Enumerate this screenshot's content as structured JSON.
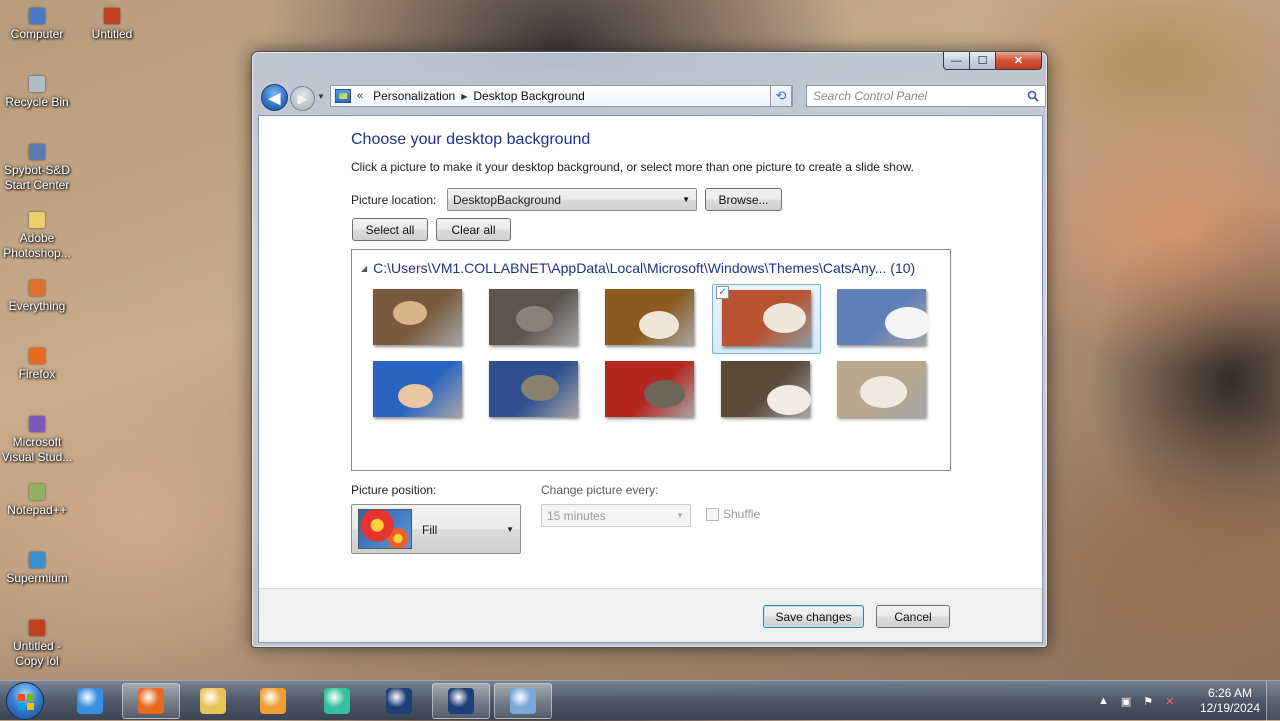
{
  "desktop": {
    "icons": [
      {
        "label": "Computer",
        "color": "#4a78c8"
      },
      {
        "label": "Untitled",
        "color": "#c04020"
      },
      {
        "label": "Recycle Bin",
        "color": "#b0bcc8"
      },
      {
        "label": "Spybot-S&D Start Center",
        "color": "#5a7ab0"
      },
      {
        "label": "Adobe Photoshop...",
        "color": "#e8d070"
      },
      {
        "label": "Everything",
        "color": "#e07030"
      },
      {
        "label": "Firefox",
        "color": "#e86a20"
      },
      {
        "label": "Microsoft Visual Stud...",
        "color": "#7a5ab8"
      },
      {
        "label": "Notepad++",
        "color": "#8fb060"
      },
      {
        "label": "Supermium",
        "color": "#3a90d0"
      },
      {
        "label": "Untitled - Copy lol",
        "color": "#c04020"
      }
    ]
  },
  "window": {
    "caption": {
      "minimize": "—",
      "maximize": "☐",
      "close": "✕"
    },
    "nav": {
      "back_icon": "back-arrow-icon",
      "forward_icon": "forward-arrow-icon",
      "address_prefix": "«",
      "breadcrumb": [
        "Personalization",
        "Desktop Background"
      ],
      "search_placeholder": "Search Control Panel"
    },
    "heading": "Choose your desktop background",
    "subtext": "Click a picture to make it your desktop background, or select more than one picture to create a slide show.",
    "picture_location": {
      "label": "Picture location:",
      "value": "DesktopBackground",
      "browse": "Browse..."
    },
    "select_all": "Select all",
    "clear_all": "Clear all",
    "gallery": {
      "group_header": "C:\\Users\\VM1.COLLABNET\\AppData\\Local\\Microsoft\\Windows\\Themes\\CatsAny... (10)",
      "thumbs": [
        {
          "bg": "#7a5a3e",
          "cat": "#d9b48a",
          "selected": false,
          "checked": false
        },
        {
          "bg": "#5b5550",
          "cat": "#8a8178",
          "selected": false,
          "checked": false
        },
        {
          "bg": "#8a5a1e",
          "cat": "#f0e6d8",
          "selected": false,
          "checked": false
        },
        {
          "bg": "#b85230",
          "cat": "#efe7dc",
          "selected": true,
          "checked": true
        },
        {
          "bg": "#5f7fb8",
          "cat": "#f4f4f4",
          "selected": false,
          "checked": false
        },
        {
          "bg": "#2a64c0",
          "cat": "#e8c8a4",
          "selected": false,
          "checked": false
        },
        {
          "bg": "#2f4f8f",
          "cat": "#8a8070",
          "selected": false,
          "checked": false
        },
        {
          "bg": "#b5261e",
          "cat": "#6f6458",
          "selected": false,
          "checked": false
        },
        {
          "bg": "#5a4a3a",
          "cat": "#f1ece4",
          "selected": false,
          "checked": false
        },
        {
          "bg": "#b8a88e",
          "cat": "#efe9df",
          "selected": false,
          "checked": false
        }
      ]
    },
    "picture_position": {
      "label": "Picture position:",
      "value": "Fill"
    },
    "change_every": {
      "label": "Change picture every:",
      "value": "15 minutes"
    },
    "shuffle": {
      "label": "Shuffle",
      "checked": false
    },
    "save_button": "Save changes",
    "cancel_button": "Cancel"
  },
  "taskbar": {
    "apps": [
      {
        "name": "internet-explorer-icon",
        "color": "#3a8fe0",
        "active": false
      },
      {
        "name": "firefox-icon",
        "color": "#e86a20",
        "active": true
      },
      {
        "name": "explorer-folder-icon",
        "color": "#e8c45a",
        "active": false
      },
      {
        "name": "media-player-icon",
        "color": "#f0a030",
        "active": false
      },
      {
        "name": "fish-app-icon",
        "color": "#36c0a0",
        "active": false
      },
      {
        "name": "photoshop-icon",
        "color": "#1b3f78",
        "active": false
      },
      {
        "name": "photoshop-icon-2",
        "color": "#1b3f78",
        "active": true
      },
      {
        "name": "control-panel-icon",
        "color": "#7aa8d8",
        "active": true
      }
    ],
    "clock_time": "6:26 AM",
    "clock_date": "12/19/2024"
  }
}
